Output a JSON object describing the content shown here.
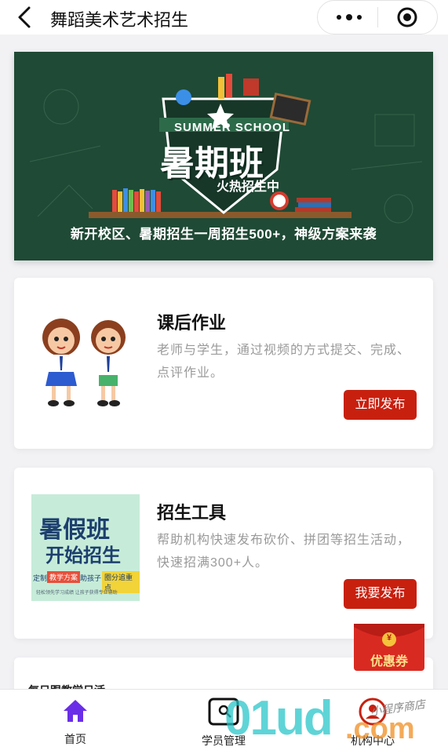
{
  "header": {
    "title": "舞蹈美术艺术招生"
  },
  "banner": {
    "summer": "SUMMER SCHOOL",
    "big_title": "暑期班",
    "hot": "火热招生中",
    "caption": "新开校区、暑期招生一周招生500+，神级方案来袭"
  },
  "cards": [
    {
      "title": "课后作业",
      "desc": "老师与学生，通过视频的方式提交、完成、点评作业。",
      "button": "立即发布"
    },
    {
      "title": "招生工具",
      "desc": "帮助机构快速发布砍价、拼团等招生活动，快速招满300+人。",
      "button": "我要发布",
      "image": {
        "line1": "暑假班",
        "line2": "开始招生",
        "tag_left": "定制",
        "tag_mid": "教学方案",
        "tag_mid2": "助孩子",
        "tag_right": "圈分追重点",
        "footer": "轻松领先学习成绩 让孩子获得专业辅助"
      }
    },
    {
      "title": "每日跟教学日活"
    }
  ],
  "coupon": {
    "label": "优惠券",
    "symbol": "¥"
  },
  "tabbar": [
    {
      "label": "首页",
      "active": true
    },
    {
      "label": "学员管理"
    },
    {
      "label": "机构中心"
    }
  ],
  "watermark": {
    "main": "01ud",
    "sub": ".com",
    "script": "小程序商店"
  },
  "colors": {
    "accent": "#c8200f",
    "tab_active": "#6a2ee8",
    "banner_bg": "#1f4a35"
  }
}
